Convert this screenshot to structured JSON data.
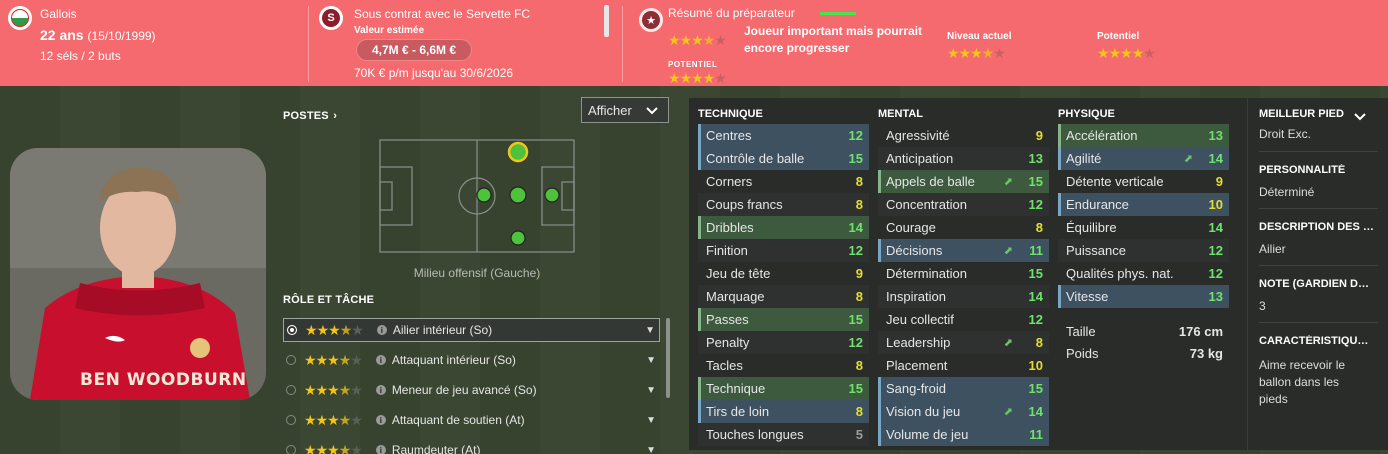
{
  "header": {
    "nationality": "Gallois",
    "age": "22 ans",
    "birthdate": "(15/10/1999)",
    "caps": "12 séls / 2 buts",
    "contract": "Sous contrat avec le Servette FC",
    "value_label": "Valeur estimée",
    "value": "4,7M € - 6,6M €",
    "wage": "70K € p/m jusqu'au 30/6/2026",
    "scout_title": "Résumé du préparateur",
    "scout_summary_line1": "Joueur important mais pourrait",
    "scout_summary_line2": "encore progresser",
    "potential_small_label": "POTENTIEL",
    "current_level_label": "Niveau actuel",
    "potential_label": "Potentiel",
    "ratings": {
      "scout_current": 3.5,
      "scout_potential": 4,
      "current": 3.5,
      "potential": 4
    }
  },
  "positions": {
    "title": "POSTES",
    "chevron": "›",
    "show_button": "Afficher",
    "position_name": "Milieu offensif (Gauche)"
  },
  "photo": {
    "name_text": "BEN WOODBURN"
  },
  "roles": {
    "title": "RÔLE ET TÂCHE",
    "items": [
      {
        "label": "Ailier intérieur (So)",
        "stars": 3.5,
        "selected": true
      },
      {
        "label": "Attaquant intérieur (So)",
        "stars": 3.5
      },
      {
        "label": "Meneur de jeu avancé (So)",
        "stars": 3.5
      },
      {
        "label": "Attaquant de soutien (At)",
        "stars": 3.5
      },
      {
        "label": "Raumdeuter (At)",
        "stars": 3.5
      }
    ]
  },
  "technique": {
    "title": "TECHNIQUE",
    "rows": [
      {
        "name": "Centres",
        "value": "12"
      },
      {
        "name": "Contrôle de balle",
        "value": "15"
      },
      {
        "name": "Corners",
        "value": "8"
      },
      {
        "name": "Coups francs",
        "value": "8"
      },
      {
        "name": "Dribbles",
        "value": "14"
      },
      {
        "name": "Finition",
        "value": "12"
      },
      {
        "name": "Jeu de tête",
        "value": "9"
      },
      {
        "name": "Marquage",
        "value": "8"
      },
      {
        "name": "Passes",
        "value": "15"
      },
      {
        "name": "Penalty",
        "value": "12"
      },
      {
        "name": "Tacles",
        "value": "8"
      },
      {
        "name": "Technique",
        "value": "15"
      },
      {
        "name": "Tirs de loin",
        "value": "8"
      },
      {
        "name": "Touches longues",
        "value": "5"
      }
    ]
  },
  "mental": {
    "title": "MENTAL",
    "rows": [
      {
        "name": "Agressivité",
        "value": "9"
      },
      {
        "name": "Anticipation",
        "value": "13"
      },
      {
        "name": "Appels de balle",
        "value": "15"
      },
      {
        "name": "Concentration",
        "value": "12"
      },
      {
        "name": "Courage",
        "value": "8"
      },
      {
        "name": "Décisions",
        "value": "11"
      },
      {
        "name": "Détermination",
        "value": "15"
      },
      {
        "name": "Inspiration",
        "value": "14"
      },
      {
        "name": "Jeu collectif",
        "value": "12"
      },
      {
        "name": "Leadership",
        "value": "8"
      },
      {
        "name": "Placement",
        "value": "10"
      },
      {
        "name": "Sang-froid",
        "value": "15"
      },
      {
        "name": "Vision du jeu",
        "value": "14"
      },
      {
        "name": "Volume de jeu",
        "value": "11"
      }
    ]
  },
  "physique": {
    "title": "PHYSIQUE",
    "rows": [
      {
        "name": "Accélération",
        "value": "13"
      },
      {
        "name": "Agilité",
        "value": "14"
      },
      {
        "name": "Détente verticale",
        "value": "9"
      },
      {
        "name": "Endurance",
        "value": "10"
      },
      {
        "name": "Équilibre",
        "value": "14"
      },
      {
        "name": "Puissance",
        "value": "12"
      },
      {
        "name": "Qualités phys. nat.",
        "value": "12"
      },
      {
        "name": "Vitesse",
        "value": "13"
      }
    ],
    "height_label": "Taille",
    "height": "176 cm",
    "weight_label": "Poids",
    "weight": "73 kg"
  },
  "side": {
    "foot_label": "MEILLEUR PIED",
    "foot": "Droit Exc.",
    "personality_label": "PERSONNALITÉ",
    "personality": "Déterminé",
    "description_label": "DESCRIPTION DES MÉDIAS",
    "description": "Ailier",
    "gk_note_label": "NOTE (GARDIEN DE BUT)",
    "gk_note": "3",
    "traits_label": "CARACTÉRISTIQUES DE JEU",
    "traits_line1": "Aime recevoir le",
    "traits_line2": "ballon dans les",
    "traits_line3": "pieds"
  },
  "colors": {
    "topbar": "#f56a6e",
    "star": "#f2c51a",
    "highlight_blue": "#3e5160",
    "highlight_green": "#3d5a3e"
  }
}
